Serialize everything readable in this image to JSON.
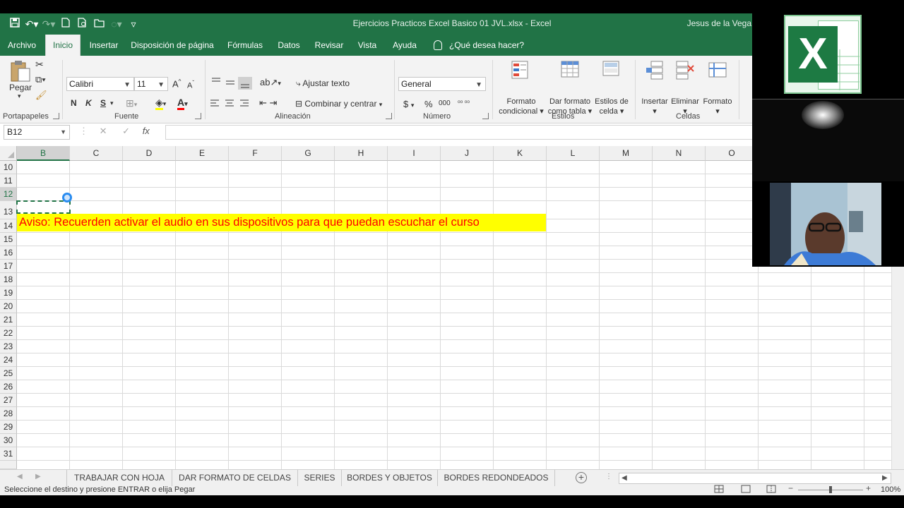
{
  "window": {
    "title": "Ejercicios Practicos Excel Basico 01 JVL.xlsx  -  Excel",
    "user": "Jesus de la Vega"
  },
  "menu_tabs": [
    "Archivo",
    "Inicio",
    "Insertar",
    "Disposición de página",
    "Fórmulas",
    "Datos",
    "Revisar",
    "Vista",
    "Ayuda"
  ],
  "active_tab": "Inicio",
  "tell_me": "¿Qué desea hacer?",
  "ribbon": {
    "clipboard": {
      "paste": "Pegar",
      "group": "Portapapeles"
    },
    "font": {
      "name": "Calibri",
      "size": "11",
      "bold": "N",
      "italic": "K",
      "underline": "S",
      "group": "Fuente"
    },
    "alignment": {
      "wrap": "Ajustar texto",
      "merge": "Combinar y centrar",
      "group": "Alineación"
    },
    "number": {
      "format": "General",
      "currency": "$",
      "percent": "%",
      "thousands": "000",
      "group": "Número"
    },
    "styles": {
      "conditional": [
        "Formato",
        "condicional"
      ],
      "table": [
        "Dar formato",
        "como tabla"
      ],
      "cell": [
        "Estilos de",
        "celda"
      ],
      "group": "Estilos"
    },
    "cells": {
      "insert": "Insertar",
      "delete": "Eliminar",
      "format": "Formato",
      "group": "Celdas"
    }
  },
  "formula_bar": {
    "name_box": "B12",
    "fx": "fx",
    "value": ""
  },
  "columns": [
    "B",
    "C",
    "D",
    "E",
    "F",
    "G",
    "H",
    "I",
    "J",
    "K",
    "L",
    "M",
    "N",
    "O"
  ],
  "selected_column": "B",
  "rows": [
    "10",
    "11",
    "12",
    "13",
    "14",
    "15",
    "16",
    "17",
    "18",
    "19",
    "20",
    "21",
    "22",
    "23",
    "24",
    "25",
    "26",
    "27",
    "28",
    "29",
    "30",
    "31"
  ],
  "selected_row": "12",
  "cells": {
    "B13": "Aviso: Recuerden activar el audio en sus dispositivos para que puedan escuchar el curso"
  },
  "sheet_tabs": [
    "TRABAJAR CON HOJA",
    "DAR FORMATO DE CELDAS",
    "SERIES",
    "BORDES Y OBJETOS",
    "BORDES REDONDEADOS"
  ],
  "active_sheet": "TRABAJAR CON HOJA",
  "status": {
    "message": "Seleccione el destino y presione ENTRAR o elija Pegar",
    "zoom": "100%"
  },
  "colors": {
    "excel_green": "#217346",
    "notice_fill": "#ffff00",
    "notice_text": "#ff0000",
    "selection": "#217346"
  }
}
